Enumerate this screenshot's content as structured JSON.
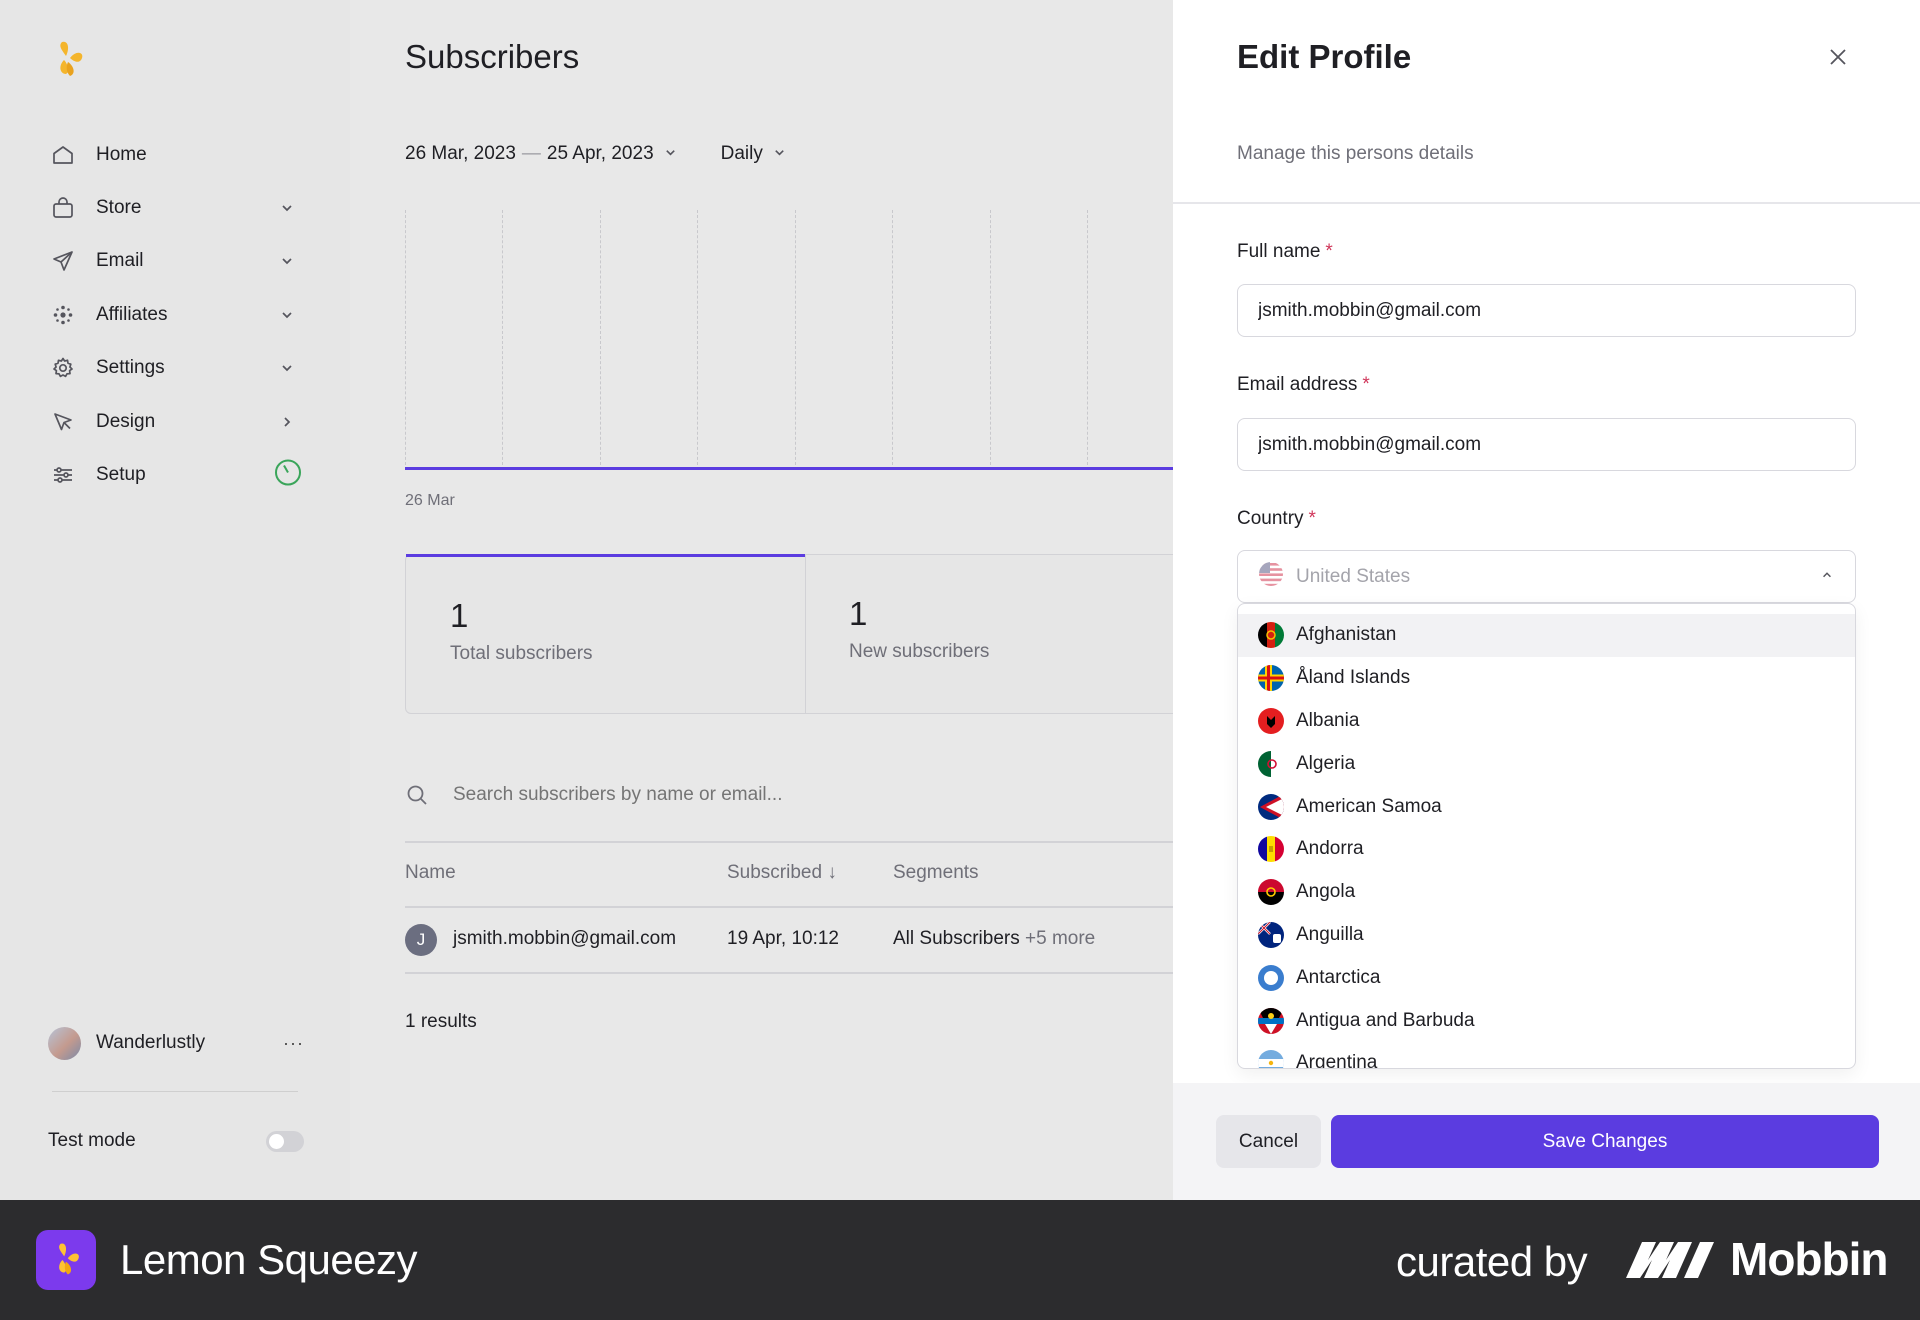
{
  "sidebar": {
    "items": [
      {
        "label": "Home",
        "icon": "home-icon"
      },
      {
        "label": "Store",
        "icon": "bag-icon"
      },
      {
        "label": "Email",
        "icon": "send-icon"
      },
      {
        "label": "Affiliates",
        "icon": "affiliates-icon"
      },
      {
        "label": "Settings",
        "icon": "gear-icon"
      },
      {
        "label": "Design",
        "icon": "cursor-icon"
      },
      {
        "label": "Setup",
        "icon": "sliders-icon"
      }
    ],
    "user_name": "Wanderlustly",
    "user_more": "···",
    "test_mode_label": "Test mode",
    "test_mode_on": false
  },
  "main": {
    "title": "Subscribers",
    "date_start": "26 Mar, 2023",
    "date_sep": "—",
    "date_end": "25 Apr, 2023",
    "interval": "Daily",
    "chart_x_start": "26 Mar",
    "stats": [
      {
        "value": "1",
        "label": "Total subscribers"
      },
      {
        "value": "1",
        "label": "New subscribers"
      }
    ],
    "search_placeholder": "Search subscribers by name or email...",
    "table": {
      "headers": {
        "name": "Name",
        "subscribed": "Subscribed ↓",
        "segments": "Segments"
      },
      "rows": [
        {
          "initial": "J",
          "name": "jsmith.mobbin@gmail.com",
          "subscribed": "19 Apr, 10:12",
          "segments": "All Subscribers",
          "more": "+5 more"
        }
      ]
    },
    "results": "1 results"
  },
  "drawer": {
    "title": "Edit Profile",
    "subtitle": "Manage this persons details",
    "full_name_label": "Full name",
    "full_name_value": "jsmith.mobbin@gmail.com",
    "email_label": "Email address",
    "email_value": "jsmith.mobbin@gmail.com",
    "country_label": "Country",
    "country_placeholder": "United States",
    "required_mark": "*",
    "countries": [
      "Afghanistan",
      "Åland Islands",
      "Albania",
      "Algeria",
      "American Samoa",
      "Andorra",
      "Angola",
      "Anguilla",
      "Antarctica",
      "Antigua and Barbuda",
      "Argentina"
    ],
    "cancel_label": "Cancel",
    "save_label": "Save Changes"
  },
  "brand": {
    "app_name": "Lemon Squeezy",
    "curated_by": "curated by",
    "curator": "Mobbin"
  },
  "colors": {
    "accent": "#5b3ce0",
    "required": "#d0365a",
    "setup_ring": "#3aa55a",
    "brand_badge": "#7c3aed"
  }
}
